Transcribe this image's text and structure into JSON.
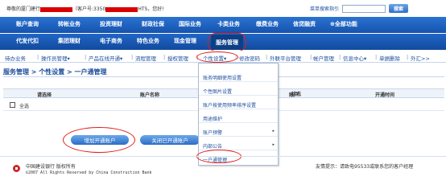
{
  "topbar": {
    "welcome_prefix": "尊敬的厦门建行",
    "welcome_mid": "（客户号:3350",
    "welcome_suffix": "HTS，您好!",
    "search_hint": "菜单搜索指引",
    "search_button": "搜索"
  },
  "nav_row1": [
    "账户查询",
    "转帐业务",
    "投资理财",
    "财政社保",
    "国际业务",
    "卡类业务",
    "缴费业务",
    "信贷融资",
    "全部功能"
  ],
  "nav_row2": [
    "代发代扣",
    "集团理财",
    "电子商务",
    "特色业务",
    "现金管理",
    "服务管理"
  ],
  "subnav": [
    "待办业务",
    "操作员管理",
    "产品在线开通",
    "流程管理",
    "授权管理",
    "个性设置",
    "修改密码",
    "外联平台管理",
    "帐户管理",
    "信息中心",
    "单据删除",
    "外汇>>"
  ],
  "breadcrumb": "服务管理 > 个性设置 > 一户通管理",
  "table": {
    "headers": [
      "请选择",
      "账户名称",
      "账户",
      "状态",
      "开通时间"
    ],
    "select_all": "全选"
  },
  "buttons": {
    "add": "增加开通账户",
    "close": "关闭已开通账户"
  },
  "dropdown": [
    {
      "label": "账务明细使用设置",
      "arrow": false
    },
    {
      "label": "个性图片设置",
      "arrow": false
    },
    {
      "label": "账户按使用频率排序设置",
      "arrow": false
    },
    {
      "label": "用途维护",
      "arrow": false
    },
    {
      "label": "账户预警",
      "arrow": true
    },
    {
      "label": "内部公告",
      "arrow": true
    },
    {
      "label": "一户通管理",
      "arrow": false
    }
  ],
  "footer": {
    "company": "中国建设银行  版权所有",
    "copyright": "©2007 All Rights Reserved by China Construction Bank",
    "note": "友情提示：请致电95533或联系您的客户经理"
  },
  "colors": {
    "nav_blue": "#1553ad",
    "highlight_red": "#e31b1b",
    "link_blue": "#1a4c9c"
  }
}
